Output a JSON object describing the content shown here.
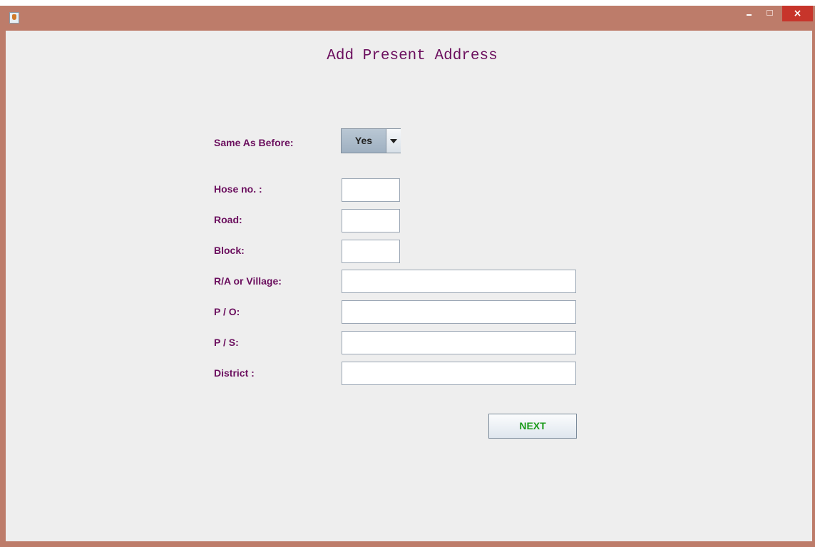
{
  "window": {
    "app_icon": "java-icon",
    "close_glyph": "×"
  },
  "form": {
    "title": "Add Present Address",
    "same_as_before": {
      "label": "Same As Before:",
      "value": "Yes"
    },
    "fields": [
      {
        "label": "Hose no. :",
        "value": ""
      },
      {
        "label": "Road:",
        "value": ""
      },
      {
        "label": "Block:",
        "value": ""
      },
      {
        "label": "R/A or Village:",
        "value": ""
      },
      {
        "label": "P / O:",
        "value": ""
      },
      {
        "label": "P / S:",
        "value": ""
      },
      {
        "label": "District :",
        "value": ""
      }
    ],
    "next_label": "NEXT"
  },
  "colors": {
    "label": "#6b0f5e",
    "next_text": "#1a9a1a",
    "titlebar": "#bd7c6a",
    "close_button": "#c7352b"
  }
}
